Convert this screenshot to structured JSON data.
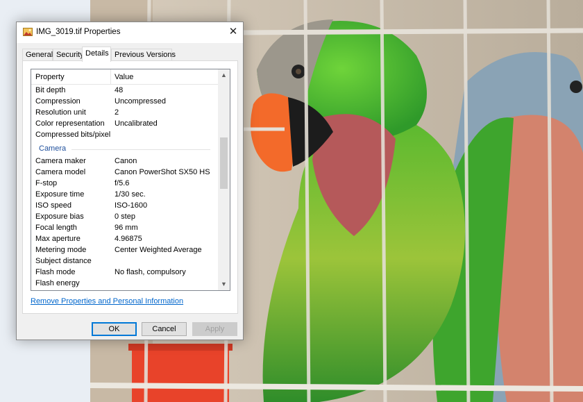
{
  "window": {
    "title": "IMG_3019.tif Properties",
    "close_glyph": "✕",
    "icon": "image-file-icon"
  },
  "tabs": [
    {
      "label": "General",
      "active": false
    },
    {
      "label": "Security",
      "active": false
    },
    {
      "label": "Details",
      "active": true
    },
    {
      "label": "Previous Versions",
      "active": false
    }
  ],
  "details": {
    "header": {
      "property": "Property",
      "value": "Value"
    },
    "rows_top": [
      {
        "property": "Bit depth",
        "value": "48"
      },
      {
        "property": "Compression",
        "value": "Uncompressed"
      },
      {
        "property": "Resolution unit",
        "value": "2"
      },
      {
        "property": "Color representation",
        "value": "Uncalibrated"
      },
      {
        "property": "Compressed bits/pixel",
        "value": ""
      }
    ],
    "group_label": "Camera",
    "rows_camera": [
      {
        "property": "Camera maker",
        "value": "Canon"
      },
      {
        "property": "Camera model",
        "value": "Canon PowerShot SX50 HS"
      },
      {
        "property": "F-stop",
        "value": "f/5.6"
      },
      {
        "property": "Exposure time",
        "value": "1/30 sec."
      },
      {
        "property": "ISO speed",
        "value": "ISO-1600"
      },
      {
        "property": "Exposure bias",
        "value": "0 step"
      },
      {
        "property": "Focal length",
        "value": "96 mm"
      },
      {
        "property": "Max aperture",
        "value": "4.96875"
      },
      {
        "property": "Metering mode",
        "value": "Center Weighted Average"
      },
      {
        "property": "Subject distance",
        "value": ""
      },
      {
        "property": "Flash mode",
        "value": "No flash, compulsory"
      },
      {
        "property": "Flash energy",
        "value": ""
      }
    ]
  },
  "remove_link": "Remove Properties and Personal Information",
  "buttons": {
    "ok": "OK",
    "cancel": "Cancel",
    "apply": "Apply"
  },
  "scroll": {
    "up_glyph": "▲",
    "down_glyph": "▼"
  },
  "colors": {
    "accent": "#0078d7",
    "link": "#0066cc",
    "group_header": "#1e4f9c"
  }
}
